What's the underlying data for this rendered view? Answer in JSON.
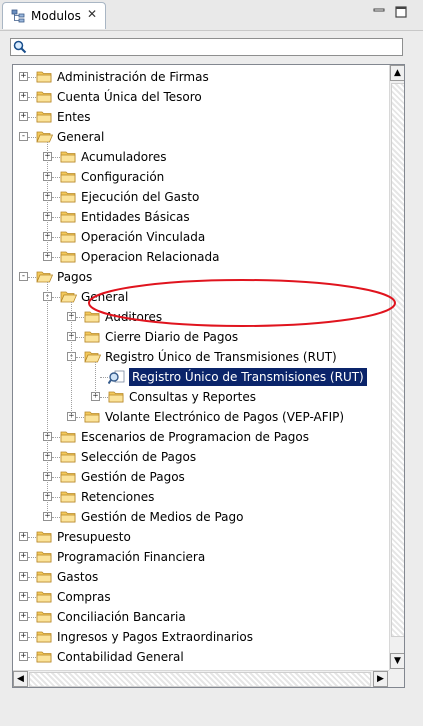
{
  "view": {
    "tab_title": "Modulos",
    "tab_icon": "hierarchy-view-icon",
    "close_glyph": "✕",
    "minimize_icon": "minimize-icon",
    "maximize_icon": "maximize-icon"
  },
  "search": {
    "value": "",
    "placeholder": "",
    "icon": "search-icon"
  },
  "tree": {
    "nodes": [
      {
        "label": "Administración de Firmas",
        "level": 0,
        "expander": "+",
        "icon": "folder-icon"
      },
      {
        "label": "Cuenta Única del Tesoro",
        "level": 0,
        "expander": "+",
        "icon": "folder-icon"
      },
      {
        "label": "Entes",
        "level": 0,
        "expander": "+",
        "icon": "folder-icon"
      },
      {
        "label": "General",
        "level": 0,
        "expander": "-",
        "icon": "folder-open-icon"
      },
      {
        "label": "Acumuladores",
        "level": 1,
        "expander": "+",
        "icon": "folder-icon"
      },
      {
        "label": "Configuración",
        "level": 1,
        "expander": "+",
        "icon": "folder-icon"
      },
      {
        "label": "Ejecución del Gasto",
        "level": 1,
        "expander": "+",
        "icon": "folder-icon"
      },
      {
        "label": "Entidades Básicas",
        "level": 1,
        "expander": "+",
        "icon": "folder-icon"
      },
      {
        "label": "Operación Vinculada",
        "level": 1,
        "expander": "+",
        "icon": "folder-icon"
      },
      {
        "label": "Operacion Relacionada",
        "level": 1,
        "expander": "+",
        "icon": "folder-icon"
      },
      {
        "label": "Pagos",
        "level": 0,
        "expander": "-",
        "icon": "folder-open-icon"
      },
      {
        "label": "General",
        "level": 1,
        "expander": "-",
        "icon": "folder-open-icon"
      },
      {
        "label": "Auditores",
        "level": 2,
        "expander": "+",
        "icon": "folder-icon"
      },
      {
        "label": "Cierre Diario de Pagos",
        "level": 2,
        "expander": "+",
        "icon": "folder-icon"
      },
      {
        "label": "Registro Único de Transmisiones (RUT)",
        "level": 2,
        "expander": "-",
        "icon": "folder-open-icon"
      },
      {
        "label": "Registro Único de Transmisiones (RUT)",
        "level": 3,
        "expander": "",
        "icon": "search-document-icon",
        "selected": true
      },
      {
        "label": "Consultas y Reportes",
        "level": 3,
        "expander": "+",
        "icon": "folder-icon"
      },
      {
        "label": "Volante Electrónico de Pagos (VEP-AFIP)",
        "level": 2,
        "expander": "+",
        "icon": "folder-icon"
      },
      {
        "label": "Escenarios de Programacion de Pagos",
        "level": 1,
        "expander": "+",
        "icon": "folder-icon"
      },
      {
        "label": "Selección de Pagos",
        "level": 1,
        "expander": "+",
        "icon": "folder-icon"
      },
      {
        "label": "Gestión de Pagos",
        "level": 1,
        "expander": "+",
        "icon": "folder-icon"
      },
      {
        "label": "Retenciones",
        "level": 1,
        "expander": "+",
        "icon": "folder-icon"
      },
      {
        "label": "Gestión de Medios de Pago",
        "level": 1,
        "expander": "+",
        "icon": "folder-icon"
      },
      {
        "label": "Presupuesto",
        "level": 0,
        "expander": "+",
        "icon": "folder-icon"
      },
      {
        "label": "Programación Financiera",
        "level": 0,
        "expander": "+",
        "icon": "folder-icon"
      },
      {
        "label": "Gastos",
        "level": 0,
        "expander": "+",
        "icon": "folder-icon"
      },
      {
        "label": "Compras",
        "level": 0,
        "expander": "+",
        "icon": "folder-icon"
      },
      {
        "label": "Conciliación Bancaria",
        "level": 0,
        "expander": "+",
        "icon": "folder-icon"
      },
      {
        "label": "Ingresos y Pagos Extraordinarios",
        "level": 0,
        "expander": "+",
        "icon": "folder-icon"
      },
      {
        "label": "Contabilidad General",
        "level": 0,
        "expander": "+",
        "icon": "folder-icon"
      }
    ]
  },
  "scrollbars": {
    "up_glyph": "▲",
    "down_glyph": "▼",
    "left_glyph": "◀",
    "right_glyph": "▶"
  },
  "colors": {
    "selection_bg": "#0a246a",
    "annotation_ellipse": "#e0141e",
    "folder_fill": "#f3c95c",
    "folder_stroke": "#b8892a"
  }
}
